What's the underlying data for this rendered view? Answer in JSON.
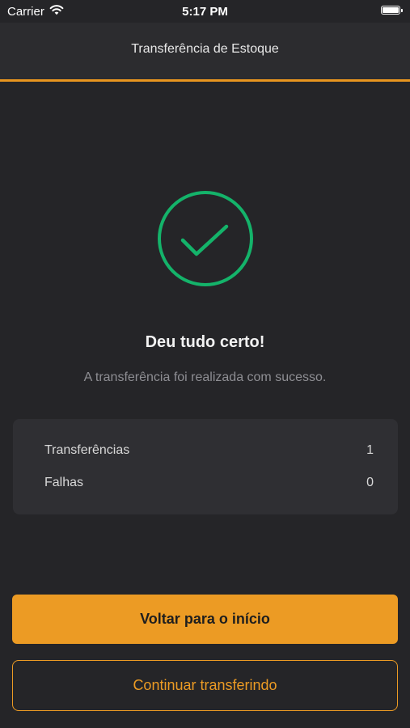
{
  "status_bar": {
    "carrier": "Carrier",
    "time": "5:17 PM",
    "icons": [
      "wifi-icon",
      "battery-icon"
    ]
  },
  "header": {
    "title": "Transferência de Estoque"
  },
  "result": {
    "icon": "check-circle-icon",
    "title": "Deu tudo certo!",
    "message": "A transferência foi realizada com sucesso."
  },
  "summary": {
    "rows": [
      {
        "label": "Transferências",
        "value": "1"
      },
      {
        "label": "Falhas",
        "value": "0"
      }
    ]
  },
  "actions": {
    "primary_label": "Voltar para o início",
    "secondary_label": "Continuar transferindo"
  },
  "colors": {
    "accent": "#ec9b24",
    "success": "#14b36a",
    "background": "#252528"
  }
}
